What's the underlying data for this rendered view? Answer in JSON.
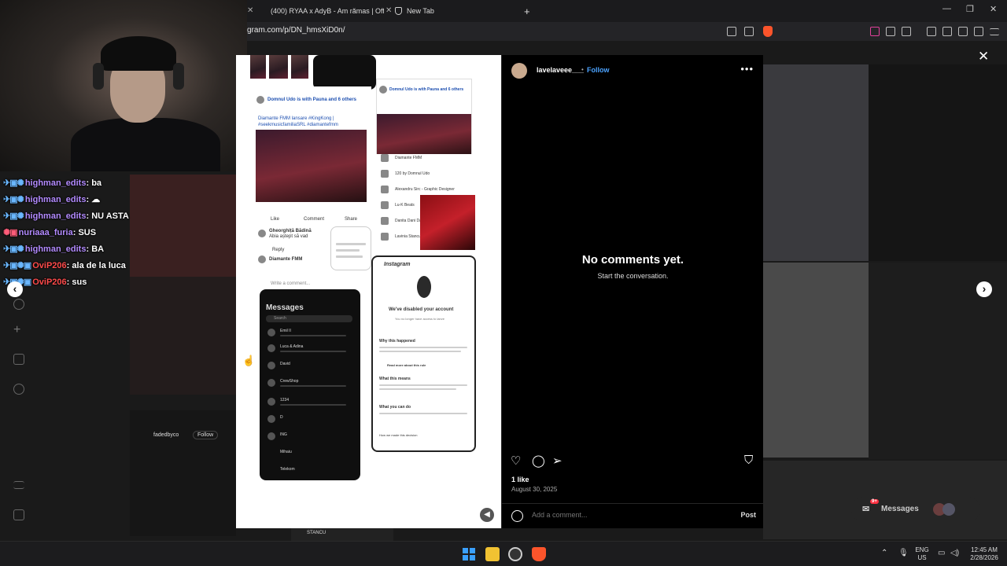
{
  "browser": {
    "tabs": [
      {
        "title": "(400) RYAA x AdyB - Am rămas | Offi",
        "icon": "youtube-icon"
      },
      {
        "title": "New Tab",
        "icon": "brave-shield-icon"
      }
    ],
    "new_tab_symbol": "+",
    "url": "gram.com/p/DN_hmsXiD0n/",
    "window_controls": [
      "—",
      "❐",
      "✕"
    ]
  },
  "chat": {
    "lines": [
      {
        "user": "highman_edits",
        "message": "ba",
        "color": "purple"
      },
      {
        "user": "highman_edits",
        "message": "☁",
        "color": "purple"
      },
      {
        "user": "highman_edits",
        "message": "NU ASTA",
        "color": "purple"
      },
      {
        "user": "nuriaaa_furia",
        "message": "SUS",
        "color": "purple"
      },
      {
        "user": "highman_edits",
        "message": "BA",
        "color": "purple"
      },
      {
        "user": "OviP206",
        "message": "ala de la luca",
        "color": "red"
      },
      {
        "user": "OviP206",
        "message": "sus",
        "color": "red"
      }
    ]
  },
  "post": {
    "username": "lavelaveee___",
    "follow_label": "Follow",
    "separator": "•",
    "more_label": "•••",
    "empty_title": "No comments yet.",
    "empty_subtitle": "Start the conversation.",
    "likes": "1 like",
    "date": "August 30, 2025",
    "comment_placeholder": "Add a comment...",
    "post_label": "Post",
    "close_symbol": "✕",
    "prev_symbol": "‹",
    "next_symbol": "›"
  },
  "image_text": {
    "fb_author": "Domnul Udo is with Pauna and 6 others",
    "fb_caption": "Diamante FMM lansare #KingKong | #seekmusicfamiliaSRL #diamantefmm",
    "fb_like": "Like",
    "fb_comment": "Comment",
    "fb_share": "Share",
    "fb_comment_author": "Gheorghiță Bădină",
    "fb_comment_text": "Abia aștept să vad",
    "fb_page": "Diamante FMM",
    "fb_write": "Write a comment...",
    "fb_reply": "Reply",
    "people": [
      "Diamante FMM",
      "120 by Domnul Udo",
      "Alexandru Sirc - Graphic Designer",
      "Lu-K Beats",
      "Danita Dani Dani",
      "Lavinia Stancu"
    ],
    "messages_title": "Messages",
    "messages_search": "Search",
    "conversations": [
      "Emil II",
      "Luca & Adina",
      "David",
      "CrewShop",
      "1234",
      "D",
      "ING",
      "Mihaiu",
      "Telekom"
    ],
    "insta_logo": "Instagram",
    "disabled_title": "We've disabled your account",
    "disabled_sub": "You no longer have access to lanve",
    "why": "Why this happened",
    "read_more": "Read more about this rule",
    "means": "What this means",
    "can_do": "What you can do",
    "how_we_made": "How we made this decision"
  },
  "background": {
    "suggested_user": "fadedbyco",
    "suggested_follow": "Follow",
    "stanco": "STANCU"
  },
  "messages_pill": {
    "label": "Messages",
    "badge": "9+"
  },
  "taskbar": {
    "lang": "ENG",
    "region": "US",
    "time": "12:45 AM",
    "date": "2/28/2026"
  }
}
